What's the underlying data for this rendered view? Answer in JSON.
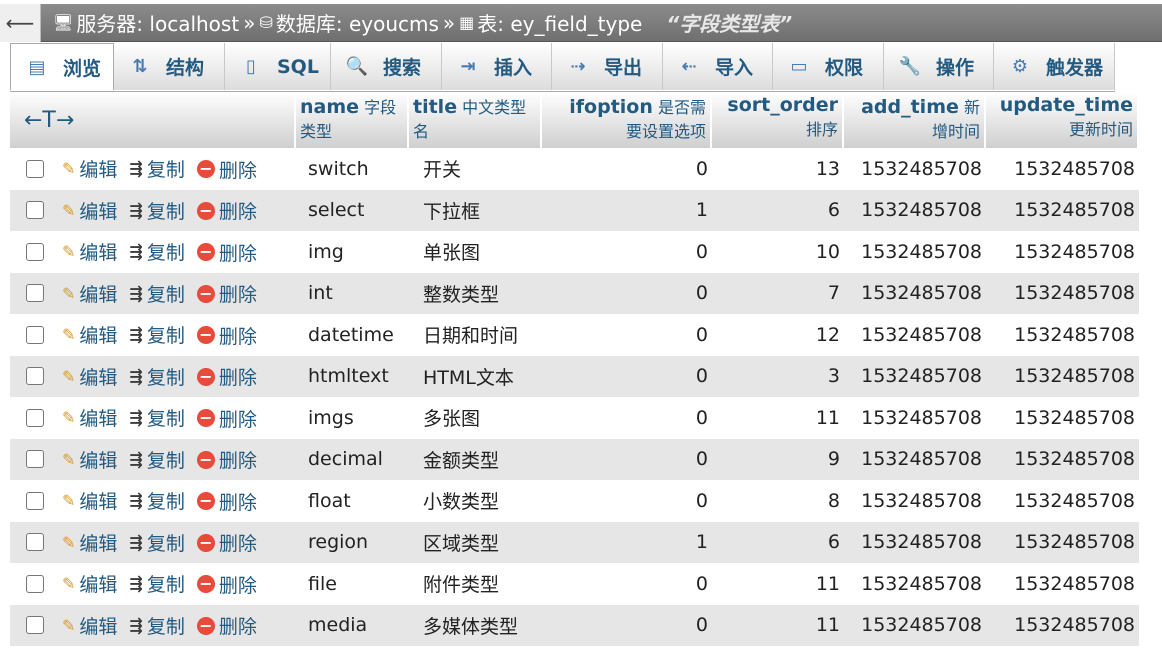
{
  "breadcrumb": {
    "server_label": "服务器: localhost",
    "db_label": "数据库: eyoucms",
    "table_label": "表: ey_field_type",
    "comment": "“字段类型表”",
    "separator": "»"
  },
  "tabs": [
    {
      "label": "浏览",
      "icon": "table-icon"
    },
    {
      "label": "结构",
      "icon": "structure-icon"
    },
    {
      "label": "SQL",
      "icon": "sql-icon"
    },
    {
      "label": "搜索",
      "icon": "search-icon"
    },
    {
      "label": "插入",
      "icon": "insert-icon"
    },
    {
      "label": "导出",
      "icon": "export-icon"
    },
    {
      "label": "导入",
      "icon": "import-icon"
    },
    {
      "label": "权限",
      "icon": "privileges-icon"
    },
    {
      "label": "操作",
      "icon": "wrench-icon"
    },
    {
      "label": "触发器",
      "icon": "triggers-icon"
    }
  ],
  "table": {
    "sort_arrows": "←T→",
    "columns": [
      {
        "name": "name",
        "comment": "字段",
        "comment2": "类型"
      },
      {
        "name": "title",
        "comment": "中文类型",
        "comment2": "名"
      },
      {
        "name": "ifoption",
        "comment": "是否需",
        "comment2": "要设置选项"
      },
      {
        "name": "sort_order",
        "comment": "",
        "comment2": "排序"
      },
      {
        "name": "add_time",
        "comment": "新",
        "comment2": "增时间"
      },
      {
        "name": "update_time",
        "comment": "",
        "comment2": "更新时间"
      }
    ],
    "actions": {
      "edit": "编辑",
      "copy": "复制",
      "delete": "删除"
    },
    "rows": [
      {
        "name": "switch",
        "title": "开关",
        "ifoption": "0",
        "sort_order": "13",
        "add_time": "1532485708",
        "update_time": "1532485708"
      },
      {
        "name": "select",
        "title": "下拉框",
        "ifoption": "1",
        "sort_order": "6",
        "add_time": "1532485708",
        "update_time": "1532485708"
      },
      {
        "name": "img",
        "title": "单张图",
        "ifoption": "0",
        "sort_order": "10",
        "add_time": "1532485708",
        "update_time": "1532485708"
      },
      {
        "name": "int",
        "title": "整数类型",
        "ifoption": "0",
        "sort_order": "7",
        "add_time": "1532485708",
        "update_time": "1532485708"
      },
      {
        "name": "datetime",
        "title": "日期和时间",
        "ifoption": "0",
        "sort_order": "12",
        "add_time": "1532485708",
        "update_time": "1532485708"
      },
      {
        "name": "htmltext",
        "title": "HTML文本",
        "ifoption": "0",
        "sort_order": "3",
        "add_time": "1532485708",
        "update_time": "1532485708"
      },
      {
        "name": "imgs",
        "title": "多张图",
        "ifoption": "0",
        "sort_order": "11",
        "add_time": "1532485708",
        "update_time": "1532485708"
      },
      {
        "name": "decimal",
        "title": "金额类型",
        "ifoption": "0",
        "sort_order": "9",
        "add_time": "1532485708",
        "update_time": "1532485708"
      },
      {
        "name": "float",
        "title": "小数类型",
        "ifoption": "0",
        "sort_order": "8",
        "add_time": "1532485708",
        "update_time": "1532485708"
      },
      {
        "name": "region",
        "title": "区域类型",
        "ifoption": "1",
        "sort_order": "6",
        "add_time": "1532485708",
        "update_time": "1532485708"
      },
      {
        "name": "file",
        "title": "附件类型",
        "ifoption": "0",
        "sort_order": "11",
        "add_time": "1532485708",
        "update_time": "1532485708"
      },
      {
        "name": "media",
        "title": "多媒体类型",
        "ifoption": "0",
        "sort_order": "11",
        "add_time": "1532485708",
        "update_time": "1532485708"
      }
    ]
  }
}
